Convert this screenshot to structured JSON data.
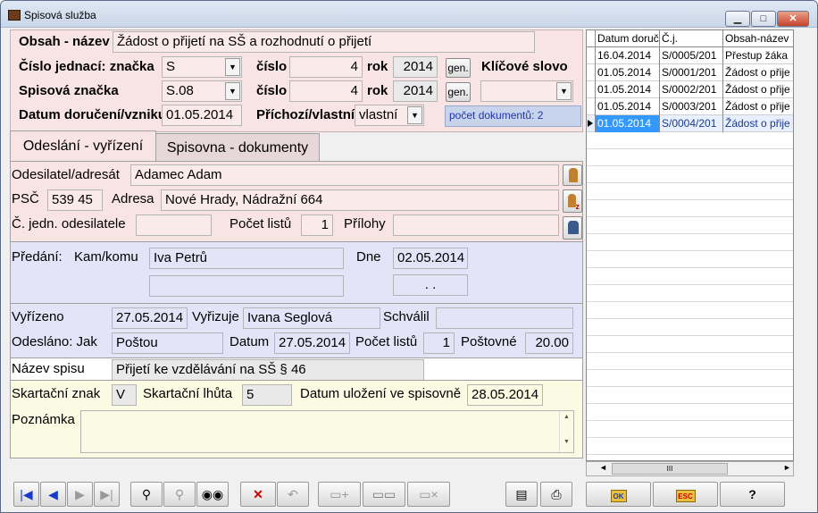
{
  "window": {
    "title": "Spisová služba"
  },
  "header": {
    "obsah_label": "Obsah - název",
    "obsah_value": "Žádost o přijetí na SŠ a rozhodnutí o přijetí",
    "cj_label": "Číslo jednací: značka",
    "cj_znacka": "S",
    "cislo_label": "číslo",
    "cj_cislo": "4",
    "rok_label": "rok",
    "cj_rok": "2014",
    "gen_label": "gen.",
    "klicove_label": "Klíčové slovo",
    "spis_label": "Spisová značka",
    "spis_znacka": "S.08",
    "spis_cislo": "4",
    "spis_rok": "2014",
    "datum_label": "Datum doručení/vzniku",
    "datum_value": "01.05.2014",
    "prichozi_label": "Příchozí/vlastní",
    "prichozi_value": "vlastní",
    "pocet_dok": "počet dokumentů: 2"
  },
  "tabs": [
    {
      "label": "Odeslání - vyřízení"
    },
    {
      "label": "Spisovna - dokumenty"
    }
  ],
  "sender": {
    "odesilatel_label": "Odesilatel/adresát",
    "odesilatel_value": "Adamec Adam",
    "psc_label": "PSČ",
    "psc_value": "539 45",
    "adresa_label": "Adresa",
    "adresa_value": "Nové Hrady, Nádražní 664",
    "cj_odes_label": "Č. jedn. odesilatele",
    "cj_odes_value": "",
    "listu_label": "Počet listů",
    "listu_value": "1",
    "prilohy_label": "Přílohy",
    "prilohy_value": ""
  },
  "predani": {
    "label": "Předání:",
    "kam_label": "Kam/komu",
    "kam_value": "Iva Petrů",
    "kam_value2": "",
    "dne_label": "Dne",
    "dne_value": "02.05.2014",
    "dne_value2": ". ."
  },
  "vyrizeni": {
    "vyrizeno_label": "Vyřízeno",
    "vyrizeno_value": "27.05.2014",
    "vyrizuje_label": "Vyřizuje",
    "vyrizuje_value": "Ivana Seglová",
    "schvalil_label": "Schválil",
    "schvalil_value": "",
    "odeslano_label": "Odesláno:  Jak",
    "jak_value": "Poštou",
    "datum_label": "Datum",
    "datum_value": "27.05.2014",
    "pocet_listu_label": "Počet listů",
    "pocet_listu_value": "1",
    "postovne_label": "Poštovné",
    "postovne_value": "20.00"
  },
  "spis": {
    "nazev_label": "Název spisu",
    "nazev_value": "Přijetí ke vzdělávání na SŠ § 46"
  },
  "skartace": {
    "znak_label": "Skartační znak",
    "znak_value": "V",
    "lhuta_label": "Skartační lhůta",
    "lhuta_value": "5",
    "ulozeni_label": "Datum uložení ve spisovně",
    "ulozeni_value": "28.05.2014",
    "poznamka_label": "Poznámka",
    "poznamka_value": ""
  },
  "grid": {
    "headers": [
      "Datum doruč",
      "Č.j.",
      "Obsah-název"
    ],
    "rows": [
      [
        "16.04.2014",
        "S/0005/201",
        "Přestup žáka"
      ],
      [
        "01.05.2014",
        "S/0001/201",
        "Žádost o přije"
      ],
      [
        "01.05.2014",
        "S/0002/201",
        "Žádost o přije"
      ],
      [
        "01.05.2014",
        "S/0003/201",
        "Žádost o přije"
      ],
      [
        "01.05.2014",
        "S/0004/201",
        "Žádost o přije"
      ]
    ],
    "selected": 4,
    "scroll_label": "III"
  },
  "toolbar": {
    "ok_label": "OK",
    "esc_label": "ESC",
    "help_label": "?"
  },
  "colors": {
    "accent": "#3399ff",
    "pink": "#f8e4e4",
    "blue": "#e4e4f8",
    "yellow": "#fbfbe4"
  }
}
